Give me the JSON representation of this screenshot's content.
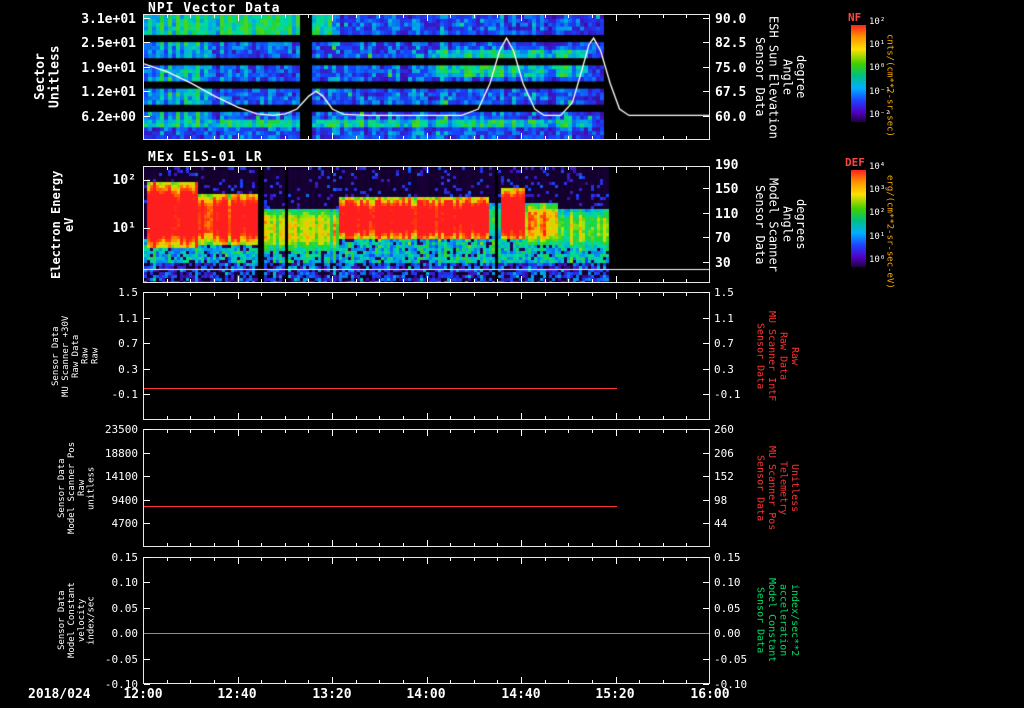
{
  "colors": {
    "background": "#000000",
    "foreground": "#ffffff",
    "red_series": "#ff3333",
    "green_series": "#00dd66",
    "orange_units": "#ffaa00"
  },
  "titles": {
    "panel1": "NPI Vector Data",
    "panel2": "MEx ELS-01 LR"
  },
  "xaxis": {
    "date": "2018/024",
    "ticks": [
      "12:00",
      "12:40",
      "13:20",
      "14:00",
      "14:40",
      "15:20",
      "16:00"
    ]
  },
  "panels": [
    {
      "left_label": [
        "Sector",
        "Unitless"
      ],
      "left_ticks": [
        "3.1e+01",
        "2.5e+01",
        "1.9e+01",
        "1.2e+01",
        "6.2e+00"
      ],
      "right_ticks": [
        "90.0",
        "82.5",
        "75.0",
        "67.5",
        "60.0"
      ],
      "right_label": [
        "Sensor Data",
        "ESH Sun Elevation",
        "Angle",
        "degree"
      ]
    },
    {
      "left_label": [
        "Electron Energy",
        "eV"
      ],
      "left_ticks": [
        "10²",
        "10¹"
      ],
      "right_ticks": [
        "190",
        "150",
        "110",
        "70",
        "30"
      ],
      "right_label": [
        "Sensor Data",
        "Model Scanner",
        "Angle",
        "degrees"
      ]
    },
    {
      "left_label": [
        "Sensor Data",
        "MU Scanner +30V",
        "Raw Data",
        "Raw",
        "Raw"
      ],
      "left_ticks": [
        "1.5",
        "1.1",
        "0.7",
        "0.3",
        "-0.1"
      ],
      "right_ticks": [
        "1.5",
        "1.1",
        "0.7",
        "0.3",
        "-0.1"
      ],
      "right_label": [
        "Sensor Data",
        "MU Scanner IntF",
        "Raw Data",
        "Raw"
      ]
    },
    {
      "left_label": [
        "Sensor Data",
        "Model Scanner Pos",
        "Raw",
        "unitless"
      ],
      "left_ticks": [
        "23500",
        "18800",
        "14100",
        "9400",
        "4700"
      ],
      "right_ticks": [
        "260",
        "206",
        "152",
        "98",
        "44"
      ],
      "right_label": [
        "Sensor Data",
        "MU Scanner Pos",
        "Telemetry",
        "Unitless"
      ]
    },
    {
      "left_label": [
        "Sensor Data",
        "Model Constant",
        "velocity",
        "index/sec"
      ],
      "left_ticks": [
        "0.15",
        "0.10",
        "0.05",
        "0.00",
        "-0.05",
        "-0.10"
      ],
      "right_ticks": [
        "0.15",
        "0.10",
        "0.05",
        "0.00",
        "-0.05",
        "-0.10"
      ],
      "right_label": [
        "Sensor Data",
        "Model Constant",
        "acceleration",
        "index/sec**2"
      ]
    }
  ],
  "colorbars": [
    {
      "name": "NF",
      "ticks": [
        "10²",
        "10¹",
        "10⁰",
        "10⁻¹",
        "10⁻²"
      ],
      "unit": "cnts/(cm**2-sr-sec)"
    },
    {
      "name": "DEF",
      "ticks": [
        "10⁴",
        "10³",
        "10²",
        "10¹",
        "10⁰"
      ],
      "unit": "erg/(cm**2-sr-sec-eV)"
    }
  ],
  "chart_data": [
    {
      "type": "heatmap",
      "name": "NPI Vector Data",
      "x_start": "2018/024 12:00",
      "x_end": "2018/024 16:00",
      "x_tick_interval_min": 40,
      "y_label": "Sector Unitless",
      "y_ticks": [
        31,
        25,
        19,
        12,
        6.2
      ],
      "z_label": "NF cnts/(cm**2-sr-sec)",
      "z_scale": "log",
      "data_end_min": 194,
      "visual": {
        "rows": 32,
        "base_level": 0.3,
        "black_row_bands": [
          [
            5,
            6
          ],
          [
            11,
            12
          ],
          [
            17,
            18
          ],
          [
            23,
            24
          ]
        ],
        "bright_regions": [
          {
            "x": [
              0,
              0.33
            ],
            "rows": [
              0,
              4
            ],
            "level": 0.52
          },
          {
            "x": [
              0,
              0.12
            ],
            "rows": [
              0,
              26
            ],
            "level": 0.42
          },
          {
            "x": [
              0.5,
              0.78
            ],
            "rows": [
              9,
              15
            ],
            "level": 0.48
          },
          {
            "x": [
              0,
              0.79
            ],
            "rows": [
              27,
              28
            ],
            "level": 0.5
          }
        ],
        "gap_columns": [
          [
            0.27,
            0.295
          ]
        ]
      },
      "overlay_line": {
        "label": "ESH Sun Elevation Angle (degree)",
        "color": "#ffffff",
        "y_range": [
          60,
          90
        ],
        "points_min_deg": [
          [
            0,
            76
          ],
          [
            10,
            73.5
          ],
          [
            20,
            70
          ],
          [
            30,
            66
          ],
          [
            40,
            62.5
          ],
          [
            48,
            60.5
          ],
          [
            55,
            60
          ],
          [
            60,
            60.5
          ],
          [
            65,
            62
          ],
          [
            70,
            66
          ],
          [
            73,
            67.5
          ],
          [
            76,
            66
          ],
          [
            80,
            62
          ],
          [
            85,
            60.3
          ],
          [
            95,
            60
          ],
          [
            135,
            60
          ],
          [
            142,
            62
          ],
          [
            147,
            70
          ],
          [
            151,
            80
          ],
          [
            154,
            84
          ],
          [
            157,
            80
          ],
          [
            161,
            70
          ],
          [
            166,
            62
          ],
          [
            170,
            60
          ],
          [
            177,
            60
          ],
          [
            182,
            64
          ],
          [
            186,
            74
          ],
          [
            189,
            82
          ],
          [
            191,
            84
          ],
          [
            194,
            80
          ],
          [
            198,
            70
          ],
          [
            202,
            62
          ],
          [
            206,
            60
          ],
          [
            240,
            60
          ]
        ]
      }
    },
    {
      "type": "heatmap",
      "name": "MEx ELS-01 LR electron spectrogram",
      "y_label": "Electron Energy eV",
      "y_scale": "log",
      "y_ticks": [
        100,
        10
      ],
      "z_label": "DEF erg/(cm**2-sr-sec-eV)",
      "z_scale": "log",
      "data_end_frac": 0.82,
      "visual": {
        "regions": [
          {
            "x": [
              0.005,
              0.095
            ],
            "y": [
              0.12,
              0.7
            ],
            "level": 0.97
          },
          {
            "x": [
              0.095,
              0.2
            ],
            "y": [
              0.22,
              0.66
            ],
            "level": 0.9
          },
          {
            "x": [
              0.2,
              0.34
            ],
            "y": [
              0.34,
              0.72
            ],
            "level": 0.6
          },
          {
            "x": [
              0.34,
              0.61
            ],
            "y": [
              0.26,
              0.62
            ],
            "level": 0.93
          },
          {
            "x": [
              0.61,
              0.63
            ],
            "y": [
              0.3,
              0.6
            ],
            "level": 0.45
          },
          {
            "x": [
              0.63,
              0.67
            ],
            "y": [
              0.18,
              0.62
            ],
            "level": 0.95
          },
          {
            "x": [
              0.67,
              0.73
            ],
            "y": [
              0.3,
              0.66
            ],
            "level": 0.68
          },
          {
            "x": [
              0.73,
              0.82
            ],
            "y": [
              0.35,
              0.7
            ],
            "level": 0.55
          }
        ],
        "mid_band": {
          "y": [
            0.58,
            0.82
          ],
          "level": 0.48
        },
        "bottom_band": {
          "y": [
            0.82,
            1.0
          ],
          "level": 0.3
        },
        "gap_columns": [
          [
            0.2,
            0.212
          ],
          [
            0.245,
            0.252
          ],
          [
            0.618,
            0.625
          ]
        ],
        "white_line_y_frac": 0.89
      }
    },
    {
      "type": "line",
      "name": "MU Scanner +30V Raw Data",
      "color": "#ff3333",
      "y_range": [
        -0.5,
        1.5
      ],
      "constant_value": 0.0,
      "x_span_frac": [
        0,
        0.838
      ]
    },
    {
      "type": "line",
      "name": "Model Scanner Pos Raw",
      "color": "#ff3333",
      "y_range": [
        0,
        23500
      ],
      "constant_value": 8200,
      "x_span_frac": [
        0,
        0.838
      ]
    },
    {
      "type": "line",
      "name": "Model Constant velocity",
      "color": "#00dd66",
      "y_range": [
        -0.1,
        0.15
      ],
      "constant_value": 0.0,
      "x_span_frac": [
        0,
        1
      ]
    }
  ]
}
